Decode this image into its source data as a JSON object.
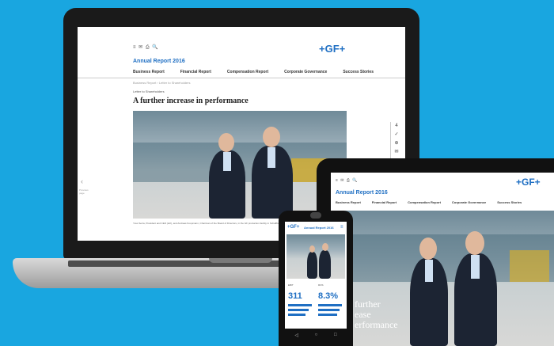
{
  "laptop": {
    "icons": [
      "menu-icon",
      "share-icon",
      "print-icon",
      "search-icon"
    ],
    "header_icons_text": "≡ ✉ ⎙ 🔍",
    "logo": "+GF+",
    "brand": "Annual Report 2016",
    "nav": [
      "Business Report",
      "Financial Report",
      "Compensation Report",
      "Corporate Governance",
      "Success Stories"
    ],
    "breadcrumb": "Business Report › Letter to Shareholders",
    "section": "Letter to Shareholders",
    "headline": "A further increase in performance",
    "caption": "Yves Serra, President and CEO (left), and Andreas Koopmann, Chairman of the Board of Directors, in the GF production facility in Schaffhausen",
    "side_label": "Previous page",
    "side_icons": [
      "4",
      "✓",
      "⊕",
      "✉"
    ]
  },
  "tablet": {
    "header_icons_text": "≡ ✉ ⎙ 🔍",
    "logo": "+GF+",
    "brand": "Annual Report 2016",
    "nav": [
      "Business Report",
      "Financial Report",
      "Compensation Report",
      "Corporate Governance",
      "Success Stories"
    ],
    "overlay_lines": [
      "further",
      "ease",
      "erformance"
    ]
  },
  "phone": {
    "logo": "+GF+",
    "brand": "Annual Report 2016",
    "stats": [
      {
        "value": "311",
        "label": "EBIT"
      },
      {
        "value": "8.3%",
        "label": "ROS"
      }
    ]
  },
  "colors": {
    "background": "#19a6e0",
    "brand_blue": "#1f6fc3"
  }
}
